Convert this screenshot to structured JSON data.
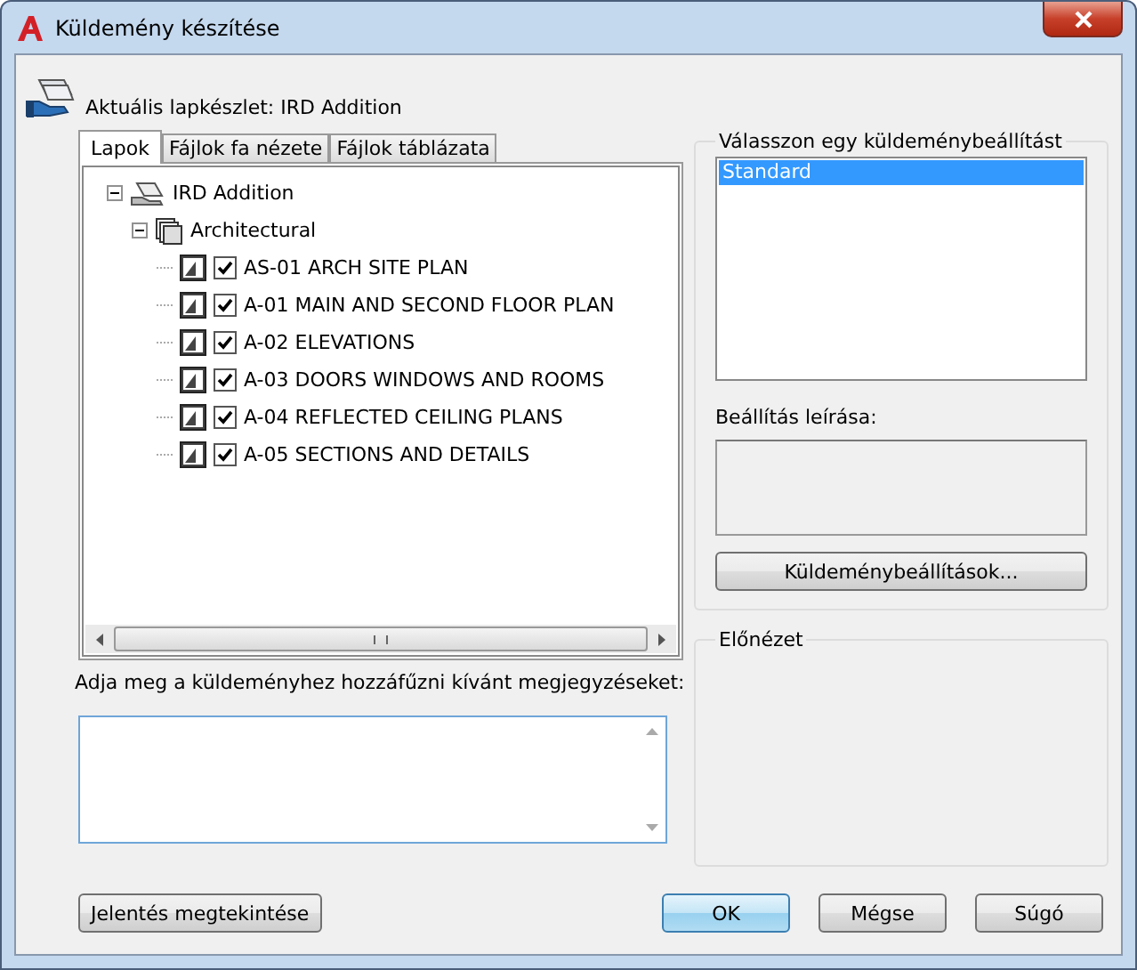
{
  "window": {
    "title": "Küldemény készítése"
  },
  "current_set": "Aktuális lapkészlet: IRD Addition",
  "tabs": [
    {
      "label": "Lapok",
      "selected": true
    },
    {
      "label": "Fájlok fa nézete",
      "selected": false
    },
    {
      "label": "Fájlok táblázata",
      "selected": false
    }
  ],
  "tree": [
    {
      "kind": "sheet_set",
      "label": "IRD Addition",
      "expanded": true,
      "children": [
        {
          "kind": "subset",
          "label": "Architectural",
          "expanded": true,
          "children": [
            {
              "kind": "sheet",
              "label": "AS-01 ARCH SITE PLAN",
              "checked": true
            },
            {
              "kind": "sheet",
              "label": "A-01 MAIN AND SECOND FLOOR PLAN",
              "checked": true
            },
            {
              "kind": "sheet",
              "label": "A-02 ELEVATIONS",
              "checked": true
            },
            {
              "kind": "sheet",
              "label": "A-03 DOORS WINDOWS AND ROOMS",
              "checked": true
            },
            {
              "kind": "sheet",
              "label": "A-04 REFLECTED CEILING PLANS",
              "checked": true
            },
            {
              "kind": "sheet",
              "label": "A-05 SECTIONS AND DETAILS",
              "checked": true
            }
          ]
        }
      ]
    }
  ],
  "notes": {
    "label": "Adja meg a küldeményhez hozzáfűzni kívánt megjegyzéseket:"
  },
  "setup_group": {
    "title": "Válasszon egy küldeménybeállítást",
    "items": [
      {
        "label": "Standard",
        "selected": true
      }
    ],
    "description_label": "Beállítás leírása:",
    "button": "Küldeménybeállítások..."
  },
  "preview_group": {
    "title": "Előnézet"
  },
  "buttons": [
    {
      "kind": "left",
      "label": "Jelentés megtekintése",
      "default": false
    },
    {
      "kind": "right",
      "label": "OK",
      "default": true
    },
    {
      "kind": "right",
      "label": "Mégse",
      "default": false
    },
    {
      "kind": "right",
      "label": "Súgó",
      "default": false
    }
  ]
}
